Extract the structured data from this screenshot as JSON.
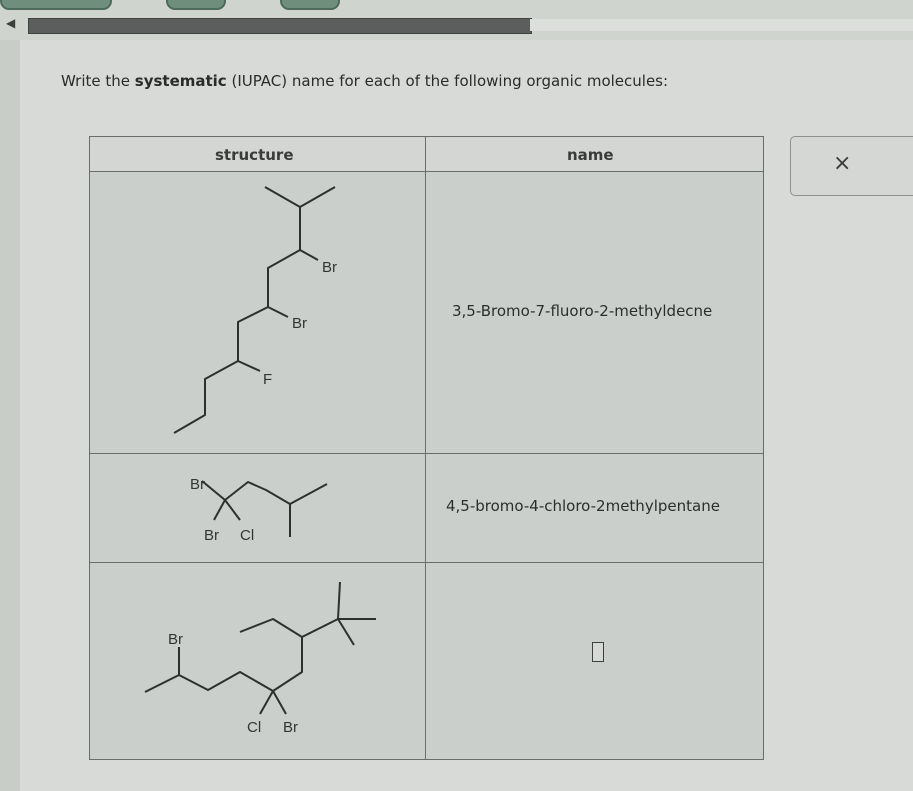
{
  "prompt": {
    "prefix": "Write the ",
    "bold": "systematic",
    "suffix": " (IUPAC) name for each of the following organic molecules:"
  },
  "table": {
    "headers": [
      "structure",
      "name"
    ],
    "rows": [
      {
        "name": "3,5-Bromo-7-fluoro-2-methyldecne",
        "atoms": [
          "Br",
          "Br",
          "F"
        ]
      },
      {
        "name": "4,5-bromo-4-chloro-2methylpentane",
        "atoms": [
          "Br",
          "Br",
          "Cl"
        ]
      },
      {
        "name": "",
        "atoms": [
          "Br",
          "Cl",
          "Br"
        ]
      }
    ]
  },
  "close_button": {
    "icon": "close-icon",
    "symbol": "×"
  }
}
